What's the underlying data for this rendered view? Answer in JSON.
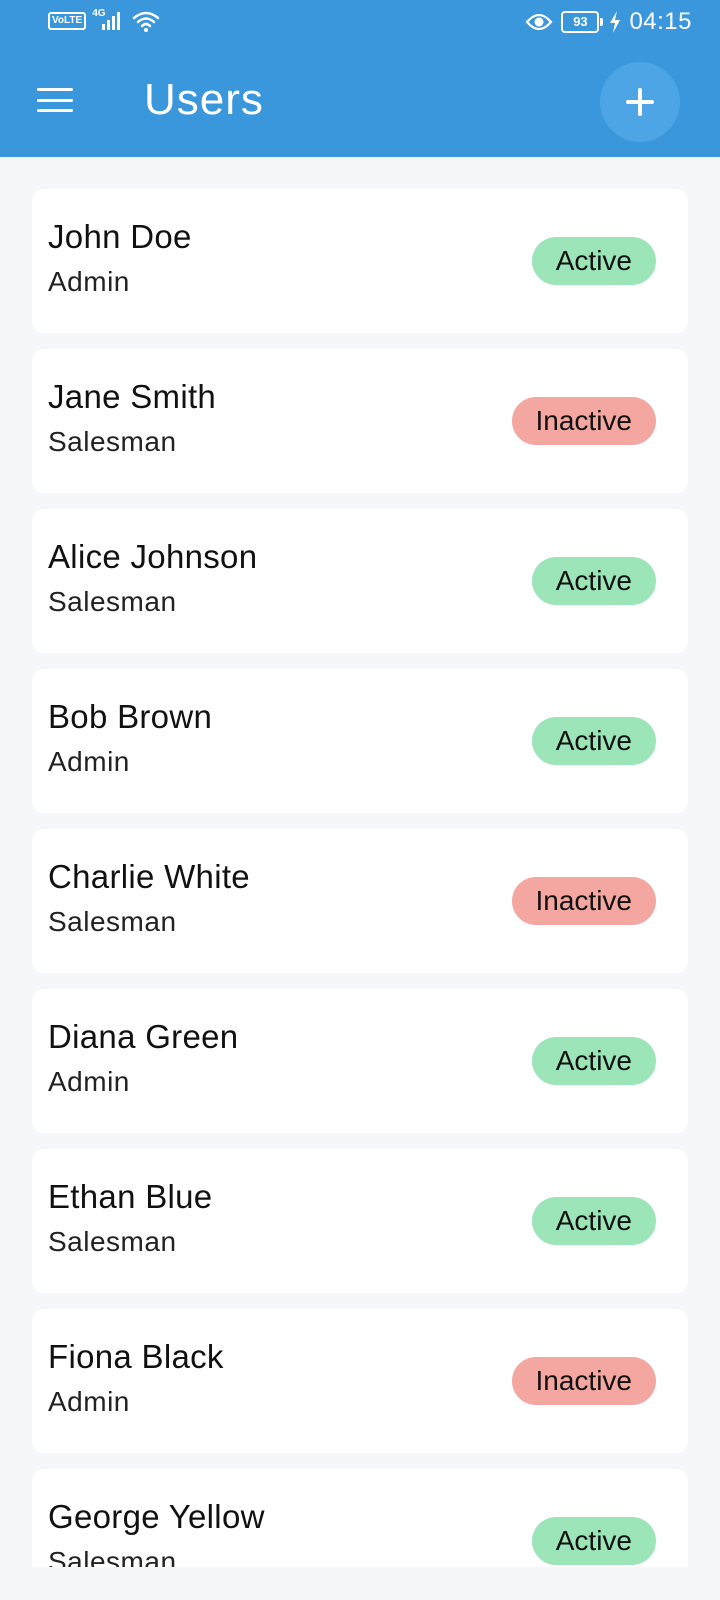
{
  "status_bar": {
    "network_badge": "VoLTE",
    "network_type": "4G",
    "battery_level": "93",
    "time": "04:15",
    "icons": [
      "volte-icon",
      "signal-icon",
      "wifi-icon",
      "eye-icon",
      "battery-icon",
      "charging-icon"
    ]
  },
  "app_bar": {
    "title": "Users",
    "menu_icon": "hamburger-menu-icon",
    "add_icon": "plus-icon",
    "color": "#3a97dc"
  },
  "colors": {
    "active": "#9be5b8",
    "inactive": "#f4a6a0"
  },
  "users": [
    {
      "name": "John Doe",
      "role": "Admin",
      "status": "Active"
    },
    {
      "name": "Jane Smith",
      "role": "Salesman",
      "status": "Inactive"
    },
    {
      "name": "Alice Johnson",
      "role": "Salesman",
      "status": "Active"
    },
    {
      "name": "Bob Brown",
      "role": "Admin",
      "status": "Active"
    },
    {
      "name": "Charlie White",
      "role": "Salesman",
      "status": "Inactive"
    },
    {
      "name": "Diana Green",
      "role": "Admin",
      "status": "Active"
    },
    {
      "name": "Ethan Blue",
      "role": "Salesman",
      "status": "Active"
    },
    {
      "name": "Fiona Black",
      "role": "Admin",
      "status": "Inactive"
    },
    {
      "name": "George Yellow",
      "role": "Salesman",
      "status": "Active"
    }
  ]
}
